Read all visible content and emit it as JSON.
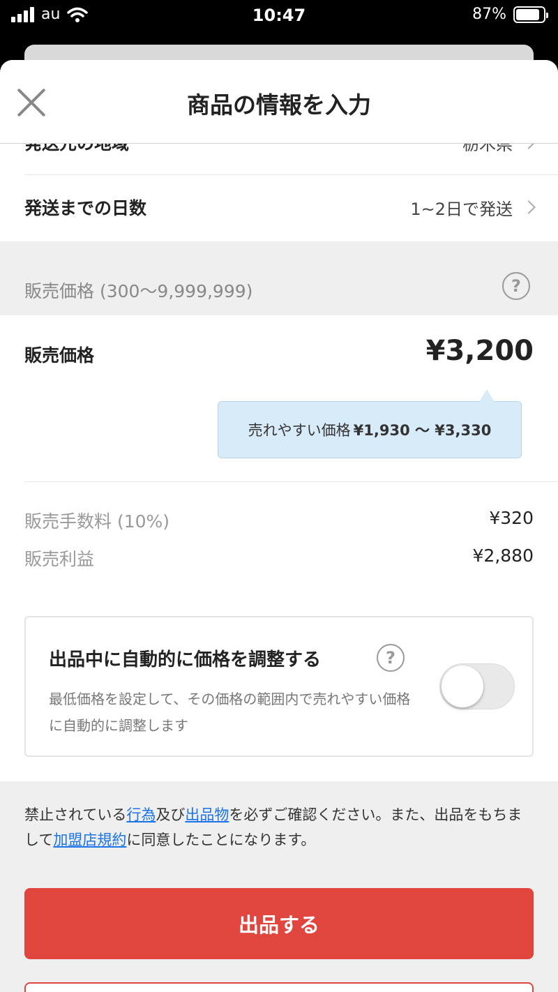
{
  "status_bar": {
    "carrier": "au",
    "time": "10:47",
    "battery": "87%",
    "battery_level": 0.87
  },
  "header": {
    "title": "商品の情報を入力",
    "close_icon": "close-icon"
  },
  "shipping": {
    "region_label": "発送元の地域",
    "region_value": "栃木県",
    "days_label": "発送までの日数",
    "days_value": "1~2日で発送"
  },
  "price_section": {
    "section_label": "販売価格 (300～9,999,999)",
    "help_icon": "?",
    "price_label": "販売価格",
    "price_value": "¥3,200",
    "tip_prefix": "売れやすい価格",
    "tip_range": "¥1,930 〜 ¥3,330",
    "fee_label": "販売手数料 (10%)",
    "fee_value": "¥320",
    "profit_label": "販売利益",
    "profit_value": "¥2,880"
  },
  "auto_adjust": {
    "title": "出品中に自動的に価格を調整する",
    "help_icon": "?",
    "description": "最低価格を設定して、その価格の範囲内で売れやすい価格に自動的に調整します",
    "enabled": false
  },
  "notice": {
    "part1": "禁止されている",
    "link1": "行為",
    "part2": "及び",
    "link2": "出品物",
    "part3": "を必ずご確認ください。また、出品をもちまして",
    "link3": "加盟店規約",
    "part4": "に同意したことになります。"
  },
  "actions": {
    "submit_label": "出品する"
  },
  "colors": {
    "accent": "#e0463e",
    "tip_bg": "#d8ebf9",
    "link": "#1a73e8"
  }
}
